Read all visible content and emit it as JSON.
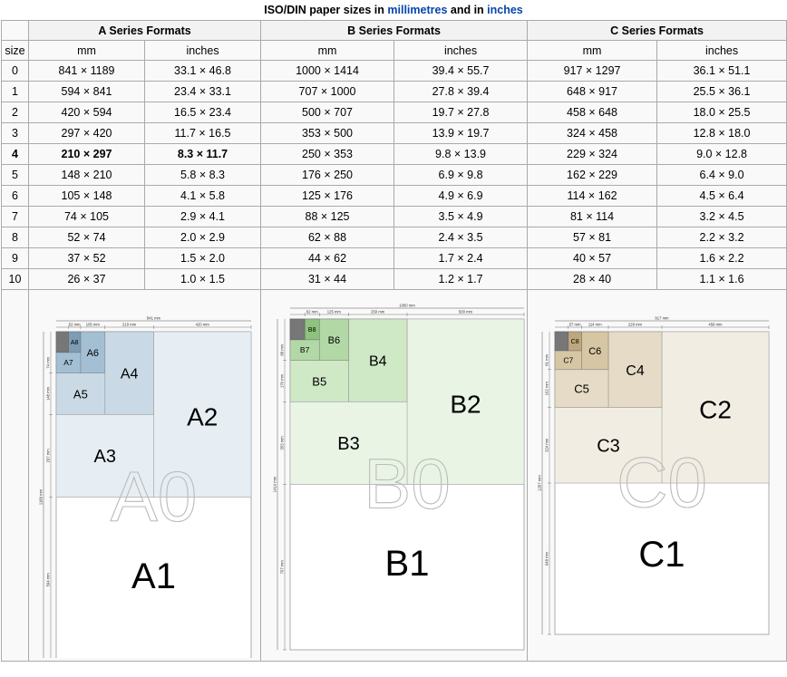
{
  "caption": {
    "prefix": "ISO/DIN paper sizes in ",
    "link_mm": "millimetres",
    "middle": " and in ",
    "link_in": "inches"
  },
  "groups": [
    "A Series Formats",
    "B Series Formats",
    "C Series Formats"
  ],
  "size_header": "size",
  "unit_mm": "mm",
  "unit_in": "inches",
  "rows": [
    {
      "size": "0",
      "a_mm": "841 × 1189",
      "a_in": "33.1 × 46.8",
      "b_mm": "1000 × 1414",
      "b_in": "39.4 × 55.7",
      "c_mm": "917 × 1297",
      "c_in": "36.1 × 51.1"
    },
    {
      "size": "1",
      "a_mm": "594 × 841",
      "a_in": "23.4 × 33.1",
      "b_mm": "707 × 1000",
      "b_in": "27.8 × 39.4",
      "c_mm": "648 × 917",
      "c_in": "25.5 × 36.1"
    },
    {
      "size": "2",
      "a_mm": "420 × 594",
      "a_in": "16.5 × 23.4",
      "b_mm": "500 × 707",
      "b_in": "19.7 × 27.8",
      "c_mm": "458 × 648",
      "c_in": "18.0 × 25.5"
    },
    {
      "size": "3",
      "a_mm": "297 × 420",
      "a_in": "11.7 × 16.5",
      "b_mm": "353 × 500",
      "b_in": "13.9 × 19.7",
      "c_mm": "324 × 458",
      "c_in": "12.8 × 18.0"
    },
    {
      "size": "4",
      "a_mm": "210 × 297",
      "a_in": "8.3 × 11.7",
      "b_mm": "250 × 353",
      "b_in": "9.8 × 13.9",
      "c_mm": "229 × 324",
      "c_in": "9.0 × 12.8"
    },
    {
      "size": "5",
      "a_mm": "148 × 210",
      "a_in": "5.8 × 8.3",
      "b_mm": "176 × 250",
      "b_in": "6.9 × 9.8",
      "c_mm": "162 × 229",
      "c_in": "6.4 × 9.0"
    },
    {
      "size": "6",
      "a_mm": "105 × 148",
      "a_in": "4.1 × 5.8",
      "b_mm": "125 × 176",
      "b_in": "4.9 × 6.9",
      "c_mm": "114 × 162",
      "c_in": "4.5 × 6.4"
    },
    {
      "size": "7",
      "a_mm": "74 × 105",
      "a_in": "2.9 × 4.1",
      "b_mm": "88 × 125",
      "b_in": "3.5 × 4.9",
      "c_mm": "81 × 114",
      "c_in": "3.2 × 4.5"
    },
    {
      "size": "8",
      "a_mm": "52 × 74",
      "a_in": "2.0 × 2.9",
      "b_mm": "62 × 88",
      "b_in": "2.4 × 3.5",
      "c_mm": "57 × 81",
      "c_in": "2.2 × 3.2"
    },
    {
      "size": "9",
      "a_mm": "37 × 52",
      "a_in": "1.5 × 2.0",
      "b_mm": "44 × 62",
      "b_in": "1.7 × 2.4",
      "c_mm": "40 × 57",
      "c_in": "1.6 × 2.2"
    },
    {
      "size": "10",
      "a_mm": "26 × 37",
      "a_in": "1.0 × 1.5",
      "b_mm": "31 × 44",
      "b_in": "1.2 × 1.7",
      "c_mm": "28 × 40",
      "c_in": "1.1 × 1.6"
    }
  ],
  "highlight_row": "4",
  "diagrams": [
    {
      "series": "A",
      "big_label": "A0",
      "colors": {
        "shade1": "#e6eef3",
        "shade2": "#c9dae6",
        "shade3": "#a3bfd4",
        "shade4": "#7d9cb5",
        "dark": "#777777"
      },
      "labels": [
        "A1",
        "A2",
        "A3",
        "A4",
        "A5",
        "A6",
        "A7",
        "A8"
      ],
      "top_dims": [
        "841 mm",
        "52 mm",
        "105 mm",
        "210 mm",
        "420 mm"
      ],
      "side_dims": [
        "74 mm",
        "148 mm",
        "297 mm",
        "1189 mm",
        "594 mm"
      ]
    },
    {
      "series": "B",
      "big_label": "B0",
      "colors": {
        "shade1": "#e9f4e5",
        "shade2": "#cfe8c6",
        "shade3": "#b2d9a5",
        "shade4": "#8dc47c",
        "dark": "#777777"
      },
      "labels": [
        "B1",
        "B2",
        "B3",
        "B4",
        "B5",
        "B6",
        "B7",
        "B8"
      ],
      "top_dims": [
        "1000 mm",
        "62 mm",
        "125 mm",
        "250 mm",
        "500 mm"
      ],
      "side_dims": [
        "88 mm",
        "176 mm",
        "353 mm",
        "1414 mm",
        "707 mm"
      ]
    },
    {
      "series": "C",
      "big_label": "C0",
      "colors": {
        "shade1": "#f2ede3",
        "shade2": "#e5dbc6",
        "shade3": "#d6c6a3",
        "shade4": "#bfa77d",
        "dark": "#777777"
      },
      "labels": [
        "C1",
        "C2",
        "C3",
        "C4",
        "C5",
        "C6",
        "C7",
        "C8"
      ],
      "top_dims": [
        "917 mm",
        "57 mm",
        "114 mm",
        "229 mm",
        "458 mm"
      ],
      "side_dims": [
        "81 mm",
        "162 mm",
        "324 mm",
        "1297 mm",
        "648 mm"
      ]
    }
  ]
}
